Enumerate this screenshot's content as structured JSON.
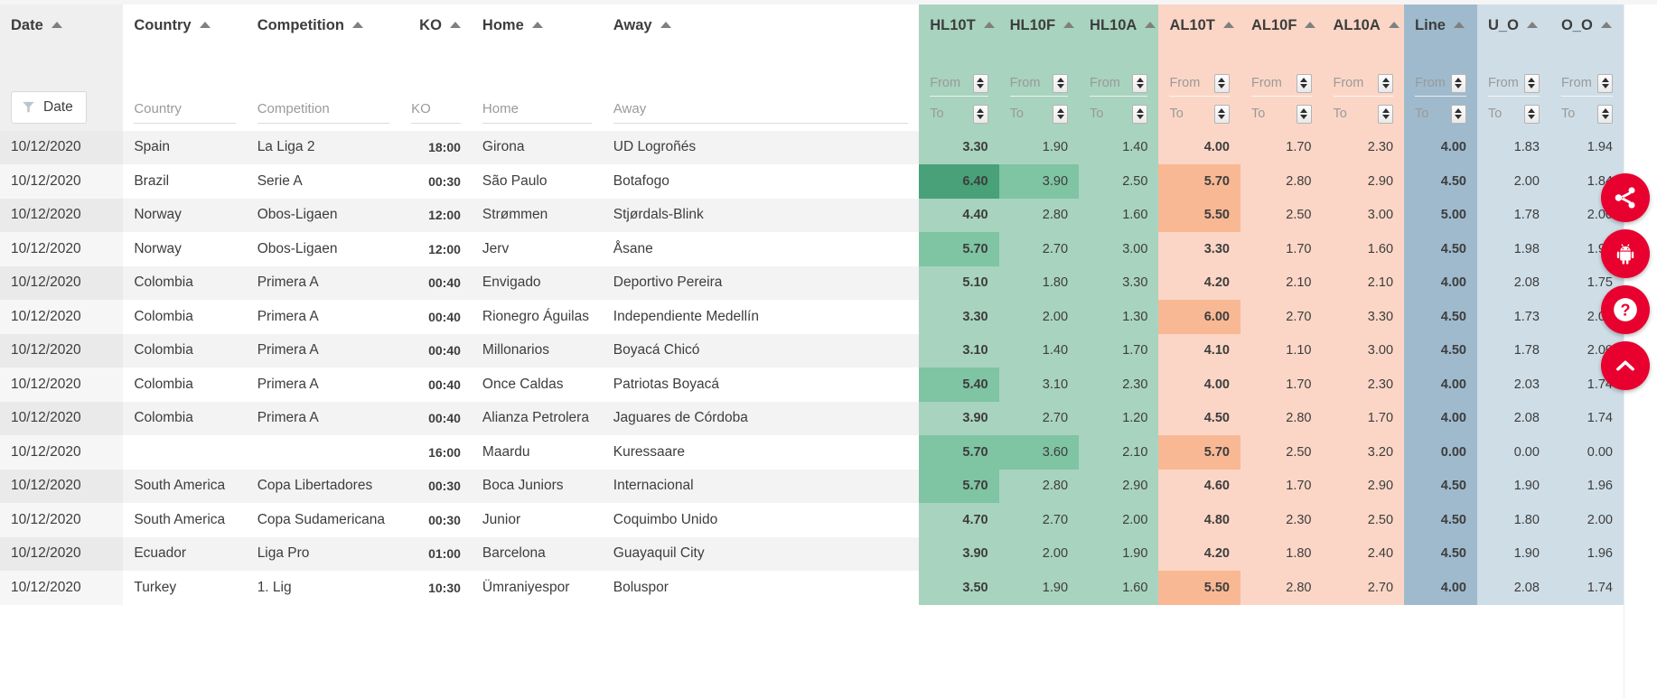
{
  "colors": {
    "green_group": "#a8d3bf",
    "green_high": "#7fc4a3",
    "green_highest": "#48a178",
    "salmon_group": "#fbd6c6",
    "salmon_high": "#f8b894",
    "line_blue": "#9fbacd",
    "uo_blue": "#cfdde6",
    "fab_red": "#e8002f",
    "text": "#3d3d3d",
    "placeholder": "#9a9a9a"
  },
  "columns": [
    {
      "key": "date",
      "label": "Date",
      "group": "plain",
      "align": "left"
    },
    {
      "key": "country",
      "label": "Country",
      "group": "plain",
      "align": "left"
    },
    {
      "key": "comp",
      "label": "Competition",
      "group": "plain",
      "align": "left"
    },
    {
      "key": "ko",
      "label": "KO",
      "group": "plain",
      "align": "right"
    },
    {
      "key": "home",
      "label": "Home",
      "group": "plain",
      "align": "left"
    },
    {
      "key": "away",
      "label": "Away",
      "group": "plain",
      "align": "left"
    },
    {
      "key": "hl10t",
      "label": "HL10T",
      "group": "gHL",
      "align": "right"
    },
    {
      "key": "hl10f",
      "label": "HL10F",
      "group": "gHL",
      "align": "right"
    },
    {
      "key": "hl10a",
      "label": "HL10A",
      "group": "gHL",
      "align": "right"
    },
    {
      "key": "al10t",
      "label": "AL10T",
      "group": "gAL",
      "align": "right"
    },
    {
      "key": "al10f",
      "label": "AL10F",
      "group": "gAL",
      "align": "right"
    },
    {
      "key": "al10a",
      "label": "AL10A",
      "group": "gAL",
      "align": "right"
    },
    {
      "key": "line",
      "label": "Line",
      "group": "gLine",
      "align": "right"
    },
    {
      "key": "u_o",
      "label": "U_O",
      "group": "gUO",
      "align": "right"
    },
    {
      "key": "o_o",
      "label": "O_O",
      "group": "gUO",
      "align": "right"
    }
  ],
  "filter_row": {
    "date_button_label": "Date",
    "date_icon": "funnel-icon",
    "country_placeholder": "Country",
    "competition_placeholder": "Competition",
    "ko_placeholder": "KO",
    "home_placeholder": "Home",
    "away_placeholder": "Away",
    "from_label": "From",
    "to_label": "To",
    "spinner_icon": "spinner-updown-icon"
  },
  "rows": [
    {
      "date": "10/12/2020",
      "country": "Spain",
      "comp": "La Liga 2",
      "ko": "18:00",
      "home": "Girona",
      "away": "UD Logroñés",
      "hl10t": "3.30",
      "hl10f": "1.90",
      "hl10a": "1.40",
      "al10t": "4.00",
      "al10f": "1.70",
      "al10a": "2.30",
      "line": "4.00",
      "u_o": "1.83",
      "o_o": "1.94"
    },
    {
      "date": "10/12/2020",
      "country": "Brazil",
      "comp": "Serie A",
      "ko": "00:30",
      "home": "São Paulo",
      "away": "Botafogo",
      "hl10t": "6.40",
      "hl10f": "3.90",
      "hl10a": "2.50",
      "al10t": "5.70",
      "al10f": "2.80",
      "al10a": "2.90",
      "line": "4.50",
      "u_o": "2.00",
      "o_o": "1.84"
    },
    {
      "date": "10/12/2020",
      "country": "Norway",
      "comp": "Obos-Ligaen",
      "ko": "12:00",
      "home": "Strømmen",
      "away": "Stjørdals-Blink",
      "hl10t": "4.40",
      "hl10f": "2.80",
      "hl10a": "1.60",
      "al10t": "5.50",
      "al10f": "2.50",
      "al10a": "3.00",
      "line": "5.00",
      "u_o": "1.78",
      "o_o": "2.00"
    },
    {
      "date": "10/12/2020",
      "country": "Norway",
      "comp": "Obos-Ligaen",
      "ko": "12:00",
      "home": "Jerv",
      "away": "Åsane",
      "hl10t": "5.70",
      "hl10f": "2.70",
      "hl10a": "3.00",
      "al10t": "3.30",
      "al10f": "1.70",
      "al10a": "1.60",
      "line": "4.50",
      "u_o": "1.98",
      "o_o": "1.90"
    },
    {
      "date": "10/12/2020",
      "country": "Colombia",
      "comp": "Primera A",
      "ko": "00:40",
      "home": "Envigado",
      "away": "Deportivo Pereira",
      "hl10t": "5.10",
      "hl10f": "1.80",
      "hl10a": "3.30",
      "al10t": "4.20",
      "al10f": "2.10",
      "al10a": "2.10",
      "line": "4.00",
      "u_o": "2.08",
      "o_o": "1.75"
    },
    {
      "date": "10/12/2020",
      "country": "Colombia",
      "comp": "Primera A",
      "ko": "00:40",
      "home": "Rionegro Águilas",
      "away": "Independiente Medellín",
      "hl10t": "3.30",
      "hl10f": "2.00",
      "hl10a": "1.30",
      "al10t": "6.00",
      "al10f": "2.70",
      "al10a": "3.30",
      "line": "4.50",
      "u_o": "1.73",
      "o_o": "2.05"
    },
    {
      "date": "10/12/2020",
      "country": "Colombia",
      "comp": "Primera A",
      "ko": "00:40",
      "home": "Millonarios",
      "away": "Boyacá Chicó",
      "hl10t": "3.10",
      "hl10f": "1.40",
      "hl10a": "1.70",
      "al10t": "4.10",
      "al10f": "1.10",
      "al10a": "3.00",
      "line": "4.50",
      "u_o": "1.78",
      "o_o": "2.00"
    },
    {
      "date": "10/12/2020",
      "country": "Colombia",
      "comp": "Primera A",
      "ko": "00:40",
      "home": "Once Caldas",
      "away": "Patriotas Boyacá",
      "hl10t": "5.40",
      "hl10f": "3.10",
      "hl10a": "2.30",
      "al10t": "4.00",
      "al10f": "1.70",
      "al10a": "2.30",
      "line": "4.00",
      "u_o": "2.03",
      "o_o": "1.74"
    },
    {
      "date": "10/12/2020",
      "country": "Colombia",
      "comp": "Primera A",
      "ko": "00:40",
      "home": "Alianza Petrolera",
      "away": "Jaguares de Córdoba",
      "hl10t": "3.90",
      "hl10f": "2.70",
      "hl10a": "1.20",
      "al10t": "4.50",
      "al10f": "2.80",
      "al10a": "1.70",
      "line": "4.00",
      "u_o": "2.08",
      "o_o": "1.74"
    },
    {
      "date": "10/12/2020",
      "country": "",
      "comp": "",
      "ko": "16:00",
      "home": "Maardu",
      "away": "Kuressaare",
      "hl10t": "5.70",
      "hl10f": "3.60",
      "hl10a": "2.10",
      "al10t": "5.70",
      "al10f": "2.50",
      "al10a": "3.20",
      "line": "0.00",
      "u_o": "0.00",
      "o_o": "0.00"
    },
    {
      "date": "10/12/2020",
      "country": "South America",
      "comp": "Copa Libertadores",
      "ko": "00:30",
      "home": "Boca Juniors",
      "away": "Internacional",
      "hl10t": "5.70",
      "hl10f": "2.80",
      "hl10a": "2.90",
      "al10t": "4.60",
      "al10f": "1.70",
      "al10a": "2.90",
      "line": "4.50",
      "u_o": "1.90",
      "o_o": "1.96"
    },
    {
      "date": "10/12/2020",
      "country": "South America",
      "comp": "Copa Sudamericana",
      "ko": "00:30",
      "home": "Junior",
      "away": "Coquimbo Unido",
      "hl10t": "4.70",
      "hl10f": "2.70",
      "hl10a": "2.00",
      "al10t": "4.80",
      "al10f": "2.30",
      "al10a": "2.50",
      "line": "4.50",
      "u_o": "1.80",
      "o_o": "2.00"
    },
    {
      "date": "10/12/2020",
      "country": "Ecuador",
      "comp": "Liga Pro",
      "ko": "01:00",
      "home": "Barcelona",
      "away": "Guayaquil City",
      "hl10t": "3.90",
      "hl10f": "2.00",
      "hl10a": "1.90",
      "al10t": "4.20",
      "al10f": "1.80",
      "al10a": "2.40",
      "line": "4.50",
      "u_o": "1.90",
      "o_o": "1.96"
    },
    {
      "date": "10/12/2020",
      "country": "Turkey",
      "comp": "1. Lig",
      "ko": "10:30",
      "home": "Ümraniyespor",
      "away": "Boluspor",
      "hl10t": "3.50",
      "hl10f": "1.90",
      "hl10a": "1.60",
      "al10t": "5.50",
      "al10f": "2.80",
      "al10a": "2.70",
      "line": "4.00",
      "u_o": "2.08",
      "o_o": "1.74"
    }
  ],
  "highlights": {
    "comment": "per-row-index -> column key -> tint level (1 = medium, 2 = strongest)",
    "1": {
      "hl10t": 2,
      "hl10f": 1,
      "al10t": 1
    },
    "2": {
      "al10t": 1
    },
    "3": {
      "hl10t": 1
    },
    "5": {
      "al10t": 1
    },
    "7": {
      "hl10t": 1
    },
    "9": {
      "hl10t": 1,
      "hl10f": 1,
      "al10t": 1
    },
    "10": {
      "hl10t": 1
    },
    "13": {
      "al10t": 1
    }
  },
  "fabs": [
    {
      "name": "share-fab",
      "icon": "share-icon"
    },
    {
      "name": "android-fab",
      "icon": "android-icon"
    },
    {
      "name": "help-fab",
      "icon": "question-mark-icon"
    },
    {
      "name": "scroll-top-fab",
      "icon": "chevron-up-icon"
    }
  ]
}
